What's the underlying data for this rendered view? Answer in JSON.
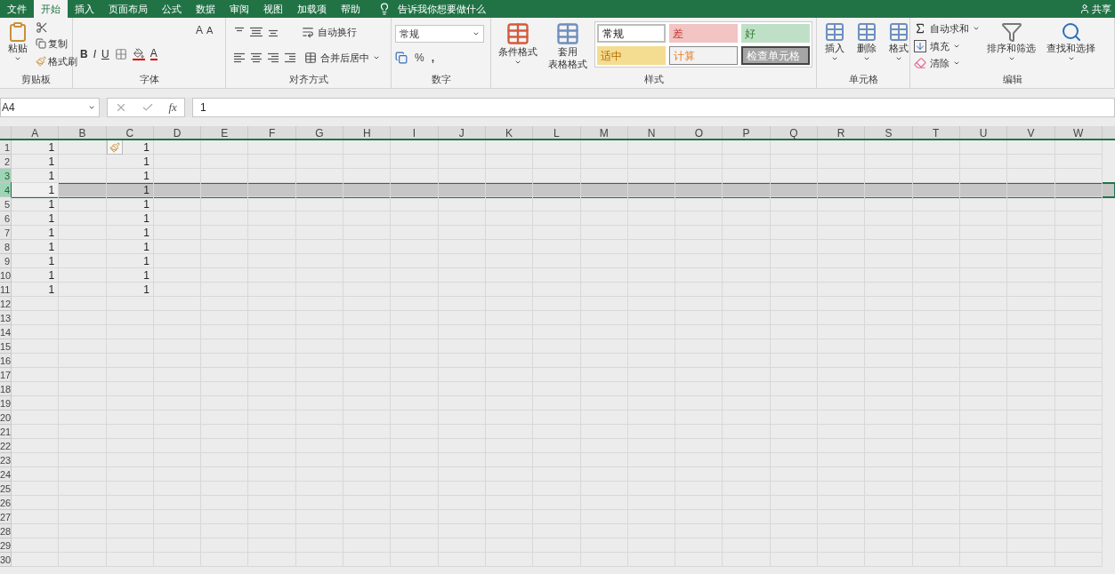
{
  "menu_tabs": [
    {
      "label": "文件",
      "selected": false
    },
    {
      "label": "开始",
      "selected": true
    },
    {
      "label": "插入",
      "selected": false
    },
    {
      "label": "页面布局",
      "selected": false
    },
    {
      "label": "公式",
      "selected": false
    },
    {
      "label": "数据",
      "selected": false
    },
    {
      "label": "审阅",
      "selected": false
    },
    {
      "label": "视图",
      "selected": false
    },
    {
      "label": "加载项",
      "selected": false
    },
    {
      "label": "帮助",
      "selected": false
    }
  ],
  "tell_me": "告诉我你想要做什么",
  "share": "共享",
  "clipboard": {
    "paste": "粘贴",
    "copy": "复制",
    "format_painter": "格式刷",
    "label": "剪贴板"
  },
  "font": {
    "bold": "B",
    "italic": "I",
    "underline": "U",
    "grow": "A",
    "shrink": "A",
    "font_color": "A",
    "label": "字体"
  },
  "alignment": {
    "wrap_text": "自动换行",
    "merge_center": "合并后居中",
    "label": "对齐方式"
  },
  "number": {
    "format": "常规",
    "percent": "%",
    "comma": ",",
    "label": "数字"
  },
  "styles": {
    "conditional_formatting": "条件格式",
    "format_as_table": [
      "套用",
      "表格格式"
    ],
    "label": "样式",
    "cell_styles": [
      {
        "label": "常规",
        "kind": "normal"
      },
      {
        "label": "差",
        "kind": "bad"
      },
      {
        "label": "好",
        "kind": "good"
      },
      {
        "label": "适中",
        "kind": "neutral"
      },
      {
        "label": "计算",
        "kind": "calculation"
      },
      {
        "label": "检查单元格",
        "kind": "check"
      }
    ]
  },
  "cells_group": {
    "insert": "插入",
    "delete": "删除",
    "format": "格式",
    "label": "单元格"
  },
  "editing": {
    "autosum": "自动求和",
    "fill": "填充",
    "clear": "清除",
    "sort_filter": "排序和筛选",
    "find_select": "查找和选择",
    "label": "编辑"
  },
  "formula_bar": {
    "name_box": "A4",
    "fx": "fx",
    "value": "1"
  },
  "columns": [
    "A",
    "B",
    "C",
    "D",
    "E",
    "F",
    "G",
    "H",
    "I",
    "J",
    "K",
    "L",
    "M",
    "N",
    "O",
    "P",
    "Q",
    "R",
    "S",
    "T",
    "U",
    "V",
    "W"
  ],
  "rows": [
    {
      "number": "1",
      "column_a": "1",
      "column_c": "1",
      "selected": false,
      "header_highlighted": false,
      "paste_options": true
    },
    {
      "number": "2",
      "column_a": "1",
      "column_c": "1",
      "selected": false,
      "header_highlighted": false
    },
    {
      "number": "3",
      "column_a": "1",
      "column_c": "1",
      "selected": false,
      "header_highlighted": true
    },
    {
      "number": "4",
      "column_a": "1",
      "column_c": "1",
      "selected": true,
      "header_highlighted": true
    },
    {
      "number": "5",
      "column_a": "1",
      "column_c": "1",
      "selected": false,
      "header_highlighted": false
    },
    {
      "number": "6",
      "column_a": "1",
      "column_c": "1",
      "selected": false,
      "header_highlighted": false
    },
    {
      "number": "7",
      "column_a": "1",
      "column_c": "1",
      "selected": false,
      "header_highlighted": false
    },
    {
      "number": "8",
      "column_a": "1",
      "column_c": "1",
      "selected": false,
      "header_highlighted": false
    },
    {
      "number": "9",
      "column_a": "1",
      "column_c": "1",
      "selected": false,
      "header_highlighted": false
    },
    {
      "number": "10",
      "column_a": "1",
      "column_c": "1",
      "selected": false,
      "header_highlighted": false
    },
    {
      "number": "11",
      "column_a": "1",
      "column_c": "1",
      "selected": false,
      "header_highlighted": false
    },
    {
      "number": "12",
      "selected": false,
      "header_highlighted": false
    },
    {
      "number": "13",
      "selected": false,
      "header_highlighted": false
    },
    {
      "number": "14",
      "selected": false,
      "header_highlighted": false
    },
    {
      "number": "15",
      "selected": false,
      "header_highlighted": false
    },
    {
      "number": "16",
      "selected": false,
      "header_highlighted": false
    },
    {
      "number": "17",
      "selected": false,
      "header_highlighted": false
    },
    {
      "number": "18",
      "selected": false,
      "header_highlighted": false
    },
    {
      "number": "19",
      "selected": false,
      "header_highlighted": false
    },
    {
      "number": "20",
      "selected": false,
      "header_highlighted": false
    },
    {
      "number": "21",
      "selected": false,
      "header_highlighted": false
    },
    {
      "number": "22",
      "selected": false,
      "header_highlighted": false
    },
    {
      "number": "23",
      "selected": false,
      "header_highlighted": false
    },
    {
      "number": "24",
      "selected": false,
      "header_highlighted": false
    },
    {
      "number": "25",
      "selected": false,
      "header_highlighted": false
    },
    {
      "number": "26",
      "selected": false,
      "header_highlighted": false
    },
    {
      "number": "27",
      "selected": false,
      "header_highlighted": false
    },
    {
      "number": "28",
      "selected": false,
      "header_highlighted": false
    },
    {
      "number": "29",
      "selected": false,
      "header_highlighted": false
    },
    {
      "number": "30",
      "selected": false,
      "header_highlighted": false
    }
  ]
}
